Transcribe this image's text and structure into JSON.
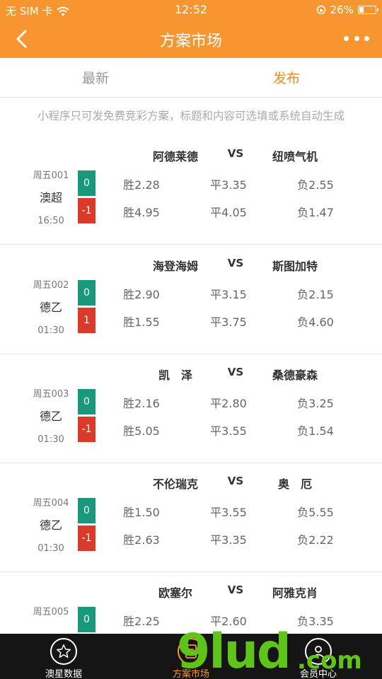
{
  "status_bar": {
    "carrier": "无 SIM 卡",
    "time": "12:52",
    "battery": "26%"
  },
  "nav": {
    "title": "方案市场"
  },
  "tabs": [
    {
      "label": "最新",
      "active": false
    },
    {
      "label": "发布",
      "active": true
    }
  ],
  "notice": "小程序只可发免费竞彩方案，标题和内容可选填或系统自动生成",
  "matches": [
    {
      "home": "阿德莱德",
      "vs": "VS",
      "away": "纽喷气机",
      "code": "周五001",
      "league": "澳超",
      "time": "16:50",
      "handicap": [
        "0",
        "-1"
      ],
      "odds": [
        [
          "胜2.28",
          "平3.35",
          "负2.55"
        ],
        [
          "胜4.95",
          "平4.05",
          "负1.47"
        ]
      ]
    },
    {
      "home": "海登海姆",
      "vs": "VS",
      "away": "斯图加特",
      "code": "周五002",
      "league": "德乙",
      "time": "01:30",
      "handicap": [
        "0",
        "1"
      ],
      "odds": [
        [
          "胜2.90",
          "平3.15",
          "负2.15"
        ],
        [
          "胜1.55",
          "平3.75",
          "负4.60"
        ]
      ]
    },
    {
      "home": "凯　泽",
      "vs": "VS",
      "away": "桑德豪森",
      "code": "周五003",
      "league": "德乙",
      "time": "01:30",
      "handicap": [
        "0",
        "-1"
      ],
      "odds": [
        [
          "胜2.16",
          "平2.80",
          "负3.25"
        ],
        [
          "胜5.05",
          "平3.55",
          "负1.54"
        ]
      ]
    },
    {
      "home": "不伦瑞克",
      "vs": "VS",
      "away": "奥　厄",
      "code": "周五004",
      "league": "德乙",
      "time": "01:30",
      "handicap": [
        "0",
        "-1"
      ],
      "odds": [
        [
          "胜1.50",
          "平3.55",
          "负5.55"
        ],
        [
          "胜2.63",
          "平3.35",
          "负2.22"
        ]
      ]
    },
    {
      "home": "欧塞尔",
      "vs": "VS",
      "away": "阿雅克肖",
      "code": "周五005",
      "league": "",
      "time": "",
      "handicap": [
        "0",
        ""
      ],
      "odds": [
        [
          "胜2.25",
          "平2.60",
          "负3.35"
        ],
        [
          "",
          "",
          ""
        ]
      ]
    }
  ],
  "bottom_nav": [
    {
      "label": "澳星数据",
      "icon": "star-icon",
      "active": false
    },
    {
      "label": "方案市场",
      "icon": "document-icon",
      "active": true
    },
    {
      "label": "会员中心",
      "icon": "user-icon",
      "active": false
    }
  ],
  "watermark": {
    "text": "9lud",
    "suffix": ".com"
  },
  "colors": {
    "brand": "#f7962e",
    "green": "#19987b",
    "red": "#d93a2a",
    "bottom_bar": "#151515"
  }
}
